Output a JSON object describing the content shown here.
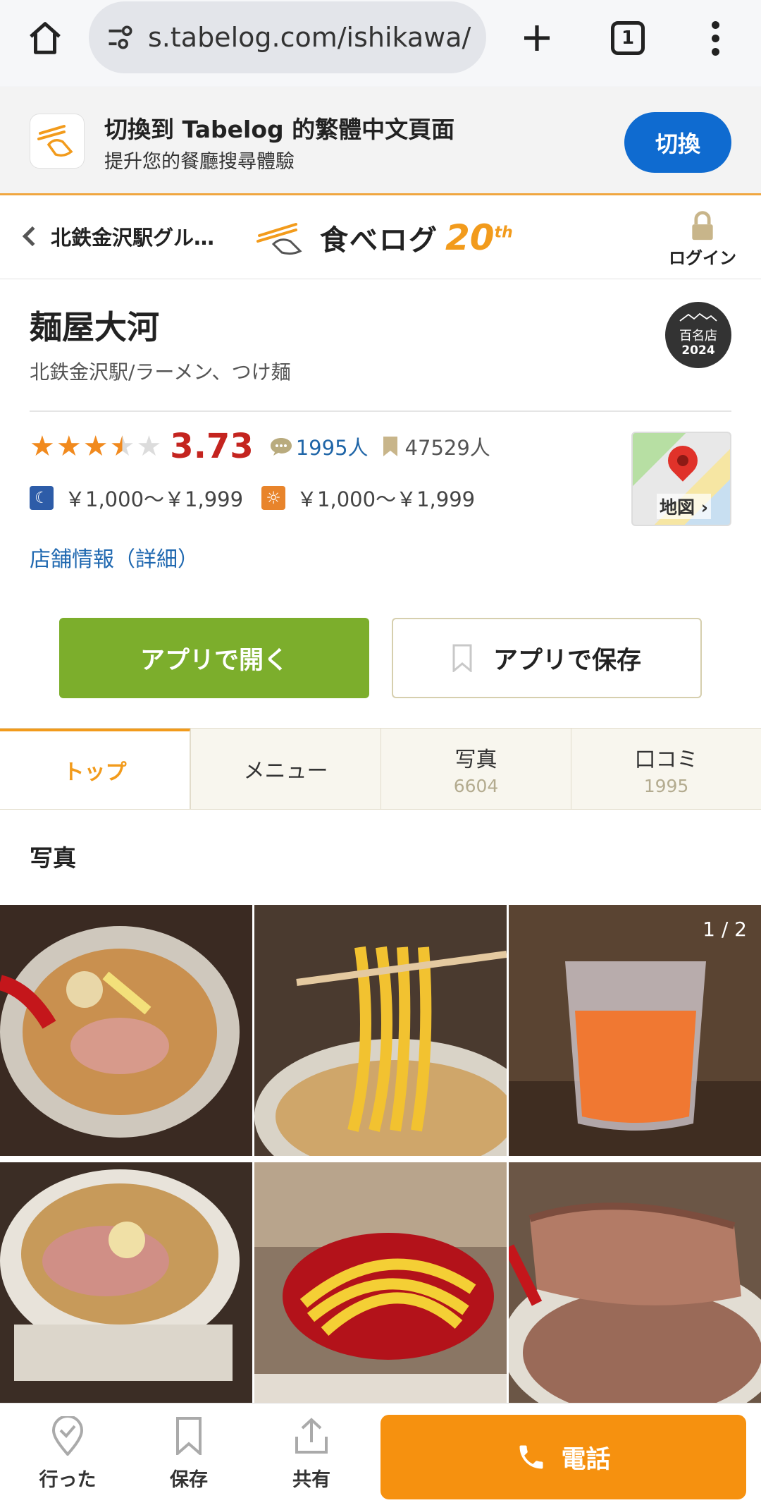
{
  "browser": {
    "url": "s.tabelog.com/ishikawa/",
    "tab_count": "1"
  },
  "translate_banner": {
    "title": "切換到 Tabelog 的繁體中文頁面",
    "subtitle": "提升您的餐廳搜尋體驗",
    "button": "切換"
  },
  "header": {
    "back_label": "北鉄金沢駅グル…",
    "logo_text": "食べログ",
    "logo_anniv": "20",
    "logo_anniv_suffix": "th",
    "login_label": "ログイン"
  },
  "restaurant": {
    "name": "麺屋大河",
    "genre": "北鉄金沢駅/ラーメン、つけ麺",
    "badge_top": "百名店",
    "badge_year": "2024",
    "rating": 3.73,
    "rating_text": "3.73",
    "review_count": "1995人",
    "bookmark_count": "47529人",
    "price_dinner": "￥1,000〜￥1,999",
    "price_lunch": "￥1,000〜￥1,999",
    "map_label": "地図 ›",
    "store_info_link": "店舗情報（詳細）"
  },
  "actions": {
    "open_app": "アプリで開く",
    "save_app": "アプリで保存"
  },
  "tabs": [
    {
      "label": "トップ",
      "count": ""
    },
    {
      "label": "メニュー",
      "count": ""
    },
    {
      "label": "写真",
      "count": "6604"
    },
    {
      "label": "口コミ",
      "count": "1995"
    }
  ],
  "photos": {
    "section_title": "写真",
    "counter": "1 / 2"
  },
  "bottom_bar": {
    "went": "行った",
    "save": "保存",
    "share": "共有",
    "call": "電話"
  },
  "colors": {
    "accent": "#f29b1c",
    "call": "#f6910f",
    "open_app": "#7cae2c",
    "rating": "#c4241f",
    "link": "#1f68b0"
  }
}
